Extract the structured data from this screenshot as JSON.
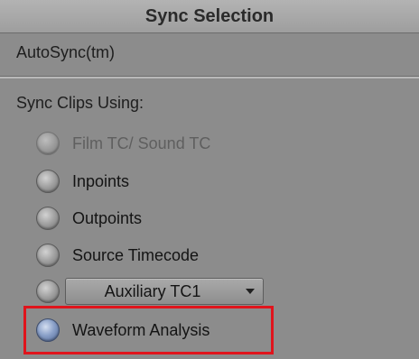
{
  "dialog": {
    "title": "Sync Selection"
  },
  "method": {
    "label": "AutoSync(tm)"
  },
  "sync_group": {
    "label": "Sync Clips Using:",
    "options": [
      {
        "label": "Film TC/ Sound TC",
        "selected": false,
        "enabled": false
      },
      {
        "label": "Inpoints",
        "selected": false,
        "enabled": true
      },
      {
        "label": "Outpoints",
        "selected": false,
        "enabled": true
      },
      {
        "label": "Source Timecode",
        "selected": false,
        "enabled": true
      },
      {
        "label": "Auxiliary TC1",
        "selected": false,
        "enabled": true,
        "type": "dropdown"
      },
      {
        "label": "Waveform Analysis",
        "selected": true,
        "enabled": true
      }
    ]
  },
  "annotation": {
    "highlight_color": "#e0141c"
  }
}
